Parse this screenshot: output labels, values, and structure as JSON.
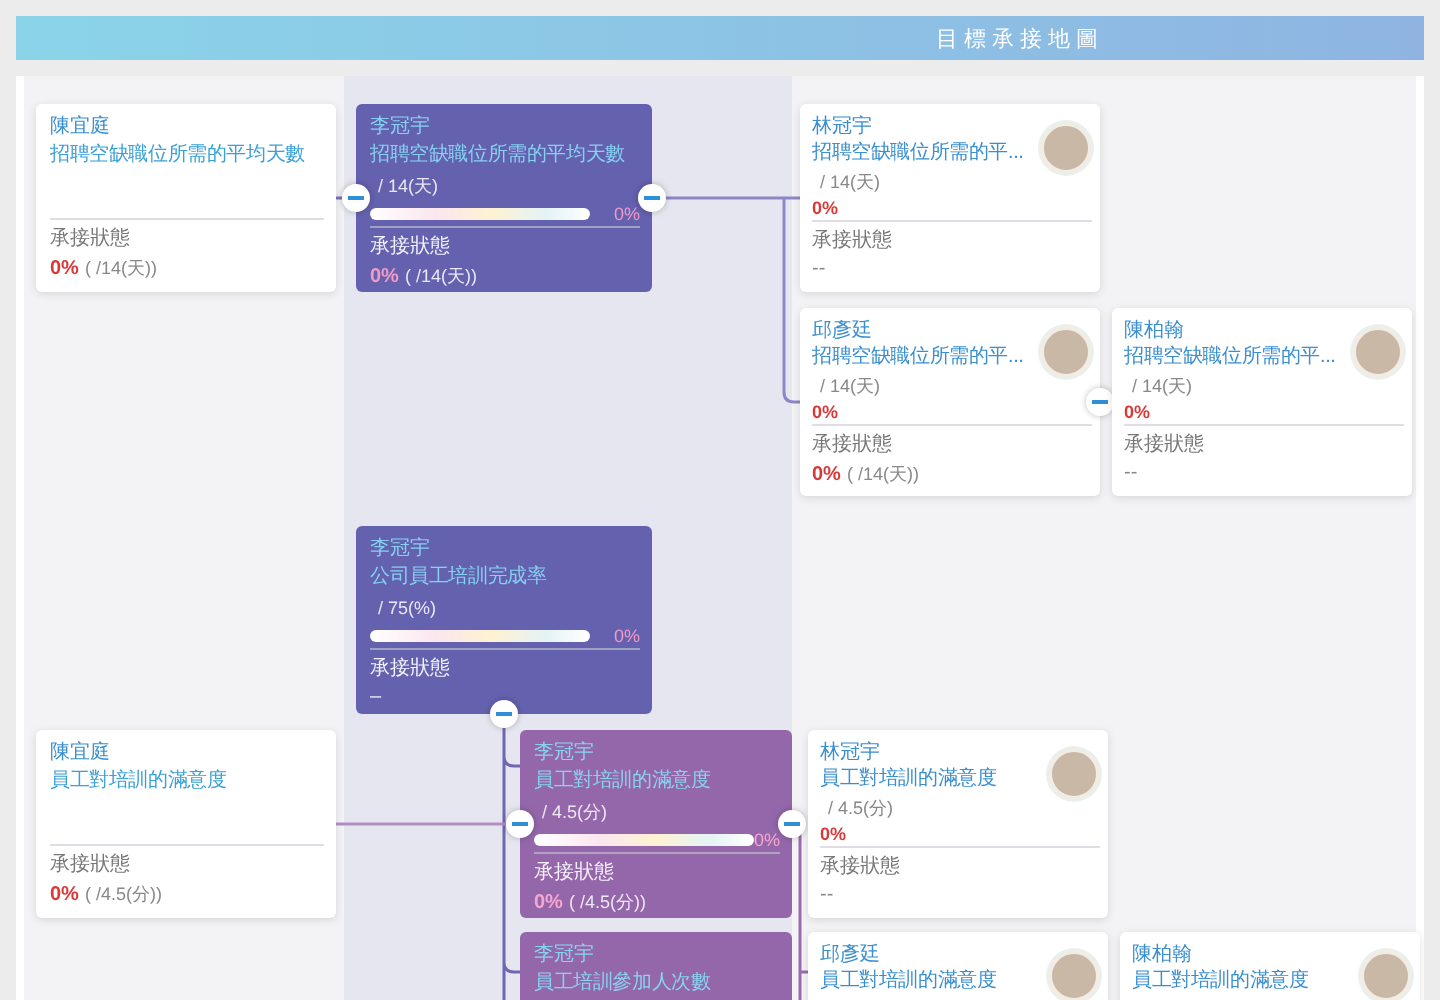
{
  "title": "目標承接地圖",
  "nodes": [
    {
      "kind": "owner",
      "owner": "陳宜庭",
      "title": "招聘空缺職位所需的平均天數",
      "status_label": "承接狀態",
      "status_value": "0%",
      "status_detail": "( /14(天))"
    },
    {
      "kind": "goal",
      "owner": "李冠宇",
      "title": "招聘空缺職位所需的平均天數",
      "target": "/ 14(天)",
      "level": 0,
      "percent": "0%",
      "status_label": "承接狀態",
      "status_value": "0%",
      "status_detail": "( /14(天))",
      "left_toggle": {
        "expanded": true
      },
      "right_toggle": {
        "expanded": true
      }
    },
    {
      "kind": "member",
      "owner": "林冠宇",
      "title": "招聘空缺職位所需的平...",
      "target": "/ 14(天)",
      "percent": "0%",
      "status_label": "承接狀態",
      "status_value": "--"
    },
    {
      "kind": "member",
      "owner": "邱彥廷",
      "title": "招聘空缺職位所需的平...",
      "target": "/ 14(天)",
      "percent": "0%",
      "status_label": "承接狀態",
      "status_value": "0%",
      "status_detail": "( /14(天))",
      "right_toggle": {
        "expanded": true
      }
    },
    {
      "kind": "member",
      "owner": "陳柏翰",
      "title": "招聘空缺職位所需的平...",
      "target": "/ 14(天)",
      "percent": "0%",
      "status_label": "承接狀態",
      "status_value": "--"
    },
    {
      "kind": "goal",
      "owner": "李冠宇",
      "title": "公司員工培訓完成率",
      "target": "/ 75(%)",
      "level": 0,
      "percent": "0%",
      "status_label": "承接狀態",
      "status_value": "–",
      "bottom_toggle": {
        "expanded": true
      }
    },
    {
      "kind": "owner",
      "owner": "陳宜庭",
      "title": "員工對培訓的滿意度",
      "status_label": "承接狀態",
      "status_value": "0%",
      "status_detail": "( /4.5(分))"
    },
    {
      "kind": "subgoal",
      "owner": "李冠宇",
      "title": "員工對培訓的滿意度",
      "target": "/ 4.5(分)",
      "level": 0,
      "percent": "0%",
      "status_label": "承接狀態",
      "status_value": "0%",
      "status_detail": "( /4.5(分))",
      "left_toggle": {
        "expanded": true
      },
      "right_toggle": {
        "expanded": true
      }
    },
    {
      "kind": "member",
      "owner": "林冠宇",
      "title": "員工對培訓的滿意度",
      "target": "/ 4.5(分)",
      "percent": "0%",
      "status_label": "承接狀態",
      "status_value": "--"
    },
    {
      "kind": "subgoal",
      "owner": "李冠宇",
      "title": "員工培訓參加人次數"
    },
    {
      "kind": "member",
      "owner": "邱彥廷",
      "title": "員工對培訓的滿意度"
    },
    {
      "kind": "member",
      "owner": "陳柏翰",
      "title": "員工對培訓的滿意度"
    }
  ]
}
